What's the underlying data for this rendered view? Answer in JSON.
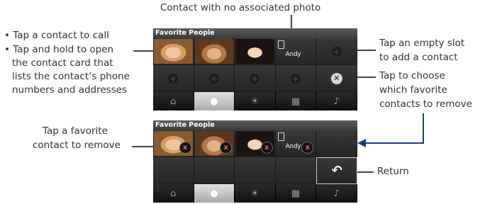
{
  "annotations": {
    "top_center": "Contact with no associated photo",
    "left_bullets": [
      "Tap a contact to call",
      "Tap and hold to open the contact card that lists the contact’s phone numbers and addresses"
    ],
    "left_bullets_lines": [
      [
        "Tap a contact to call"
      ],
      [
        "Tap and hold to open",
        "the contact card that",
        "lists the contact’s phone",
        "numbers and addresses"
      ]
    ],
    "right_add": [
      "Tap an empty slot",
      "to add a contact"
    ],
    "right_remove": [
      "Tap to choose",
      "which favorite",
      "contacts to remove"
    ],
    "bottom_left": [
      "Tap a favorite",
      "contact to remove"
    ],
    "bottom_right": "Return"
  },
  "screens": {
    "top": {
      "title": "Favorite People",
      "contact_name": "Andy",
      "icons": {
        "empty_slot": "plus-circle-icon",
        "remove": "x-circle-icon"
      }
    },
    "bottom": {
      "title": "Favorite People",
      "contact_name": "Andy",
      "remove_marker": "x",
      "return_icon": "return-arrow-icon"
    }
  },
  "nav": [
    {
      "name": "home-tab",
      "icon": "house-icon",
      "glyph": "⌂"
    },
    {
      "name": "people-tab",
      "icon": "person-icon",
      "glyph": "●",
      "active": true
    },
    {
      "name": "weather-tab",
      "icon": "sun-icon",
      "glyph": "☀"
    },
    {
      "name": "apps-tab",
      "icon": "grid-icon",
      "glyph": "▦"
    },
    {
      "name": "music-tab",
      "icon": "music-icon",
      "glyph": "♪"
    }
  ],
  "colors": {
    "accent_arrow": "#1a3f8a",
    "text": "#333333"
  }
}
